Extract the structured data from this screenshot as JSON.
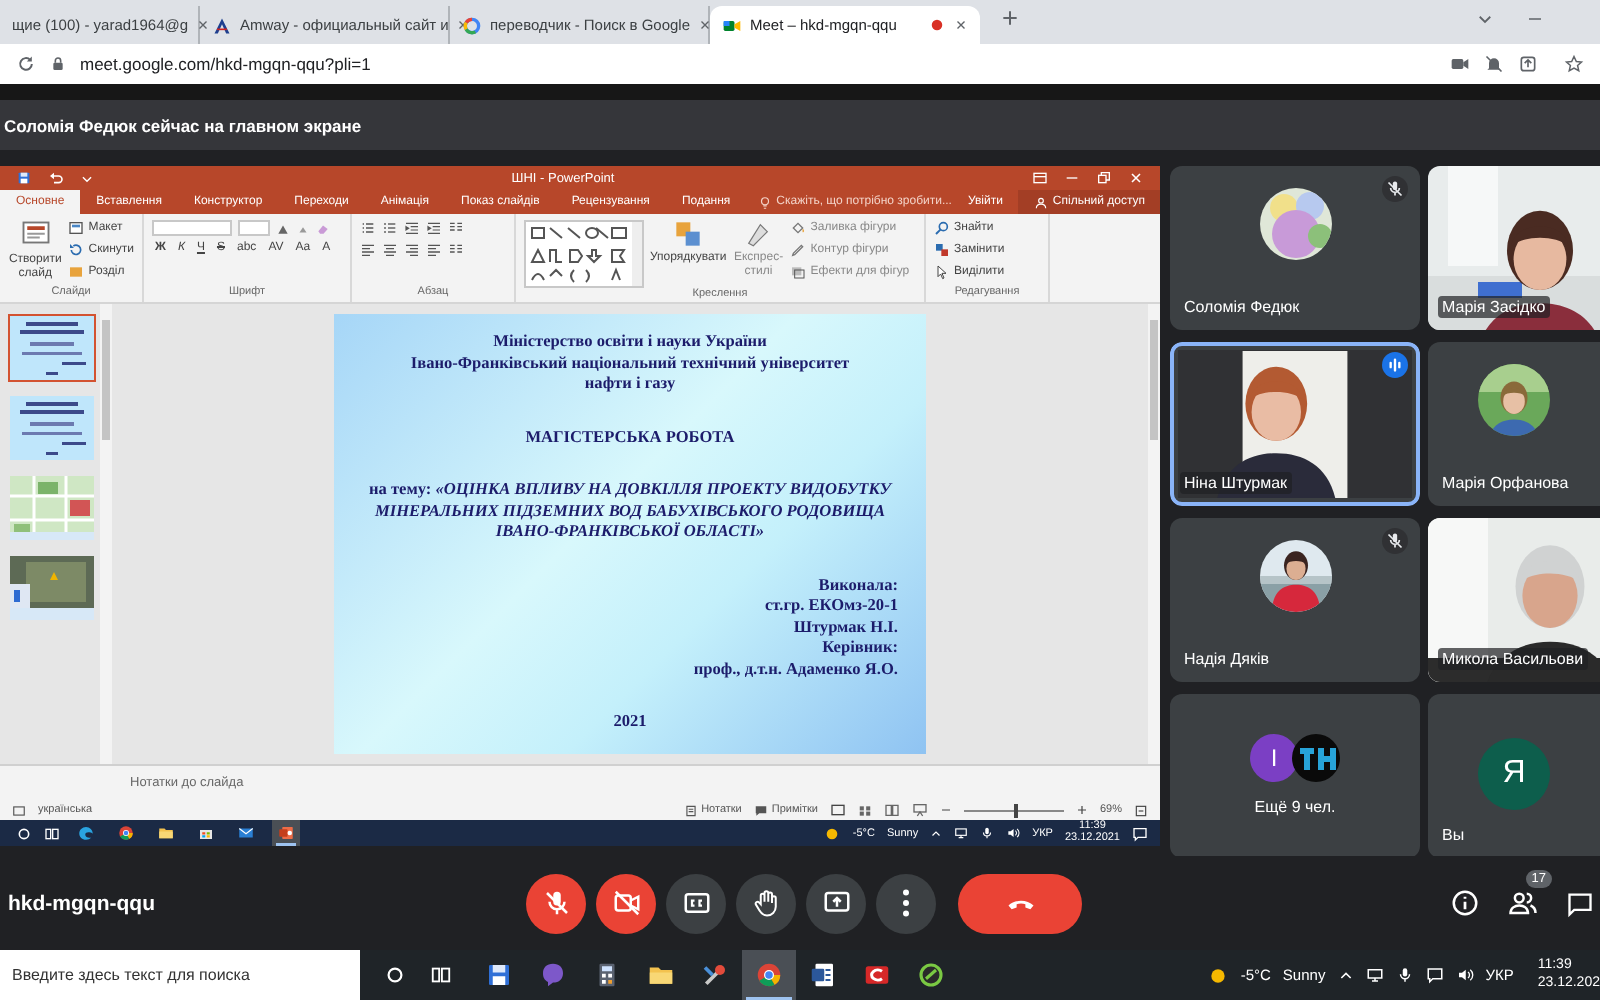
{
  "browser": {
    "tabs": [
      {
        "title": "щие (100) - yarad1964@g",
        "kind": "none",
        "selected": false,
        "recording": false
      },
      {
        "title": "Amway - официальный сайт и",
        "kind": "amway",
        "selected": false,
        "recording": false
      },
      {
        "title": "переводчик - Поиск в Google",
        "kind": "google",
        "selected": false,
        "recording": false
      },
      {
        "title": "Meet – hkd-mgqn-qqu",
        "kind": "meet",
        "selected": true,
        "recording": true
      }
    ],
    "url": "meet.google.com/hkd-mgqn-qqu?pli=1"
  },
  "meet": {
    "presenter_banner": "Соломія Федюк сейчас на главном экране",
    "participants": [
      {
        "name": "Соломія Федюк",
        "kind": "avatar",
        "muted": true,
        "speaking": false
      },
      {
        "name": "Марія Засідко",
        "kind": "video",
        "muted": false,
        "speaking": false
      },
      {
        "name": "Ніна Штурмак",
        "kind": "video",
        "muted": false,
        "speaking": true
      },
      {
        "name": "Марія Орфанова",
        "kind": "avatar",
        "muted": false,
        "speaking": false
      },
      {
        "name": "Надія Дяків",
        "kind": "avatar",
        "muted": true,
        "speaking": false
      },
      {
        "name": "Микола Васильови",
        "kind": "video",
        "muted": false,
        "speaking": false
      },
      {
        "name": "Ещё 9 чел.",
        "kind": "others",
        "muted": false,
        "speaking": false,
        "avatars": [
          {
            "kind": "initial",
            "initial": "I",
            "color": "#7b3fc4"
          },
          {
            "kind": "picture"
          }
        ]
      },
      {
        "name": "Вы",
        "kind": "self",
        "muted": false,
        "speaking": false,
        "initial": "Я",
        "color": "#0d5e4c"
      }
    ],
    "meeting_code": "hkd-mgqn-qqu",
    "controls": [
      {
        "kind": "mic",
        "off": true
      },
      {
        "kind": "camera",
        "off": true
      },
      {
        "kind": "captions",
        "off": false
      },
      {
        "kind": "hand",
        "off": false
      },
      {
        "kind": "present",
        "off": false
      },
      {
        "kind": "more",
        "off": false
      },
      {
        "kind": "hangup",
        "off": false
      }
    ],
    "people_count": "17"
  },
  "presentation": {
    "title": "ШНІ - PowerPoint",
    "tabs": [
      {
        "label": "Основне",
        "selected": true
      },
      {
        "label": "Вставлення",
        "selected": false
      },
      {
        "label": "Конструктор",
        "selected": false
      },
      {
        "label": "Переходи",
        "selected": false
      },
      {
        "label": "Анімація",
        "selected": false
      },
      {
        "label": "Показ слайдів",
        "selected": false
      },
      {
        "label": "Рецензування",
        "selected": false
      },
      {
        "label": "Подання",
        "selected": false
      }
    ],
    "tell_me": "Скажіть, що потрібно зробити...",
    "sign_in": "Увійти",
    "share": "Спільний доступ",
    "ribbon": {
      "slides": {
        "new_slide": "Створити слайд",
        "layout": "Макет",
        "reset": "Скинути",
        "section": "Розділ",
        "label": "Слайди"
      },
      "font": {
        "buttons": [
          "Ж",
          "К",
          "Ч",
          "S",
          "abc",
          "AV",
          "Aa",
          "A"
        ],
        "label": "Шрифт"
      },
      "paragraph": {
        "label": "Абзац"
      },
      "drawing": {
        "arrange": "Упорядкувати",
        "quick_styles": "Експрес-стилі",
        "fill": "Заливка фігури",
        "outline": "Контур фігури",
        "effects": "Ефекти для фігур",
        "label": "Креслення"
      },
      "editing": {
        "find": "Знайти",
        "replace": "Замінити",
        "select": "Виділити",
        "label": "Редагування"
      }
    },
    "thumbnails": [
      {
        "kind": "text",
        "selected": true
      },
      {
        "kind": "text",
        "selected": false
      },
      {
        "kind": "map",
        "selected": false
      },
      {
        "kind": "aerial",
        "selected": false
      }
    ],
    "slide": {
      "blocks": [
        {
          "kind": "center",
          "lines": [
            "Міністерство освіти і науки України",
            "Івано-Франківський національний технічний університет",
            "нафти і газу"
          ]
        },
        {
          "kind": "center",
          "lines": [
            "МАГІСТЕРСЬКА РОБОТА"
          ]
        },
        {
          "kind": "center",
          "lines": [
            "на тему:  *«ОЦІНКА ВПЛИВУ НА ДОВКІЛЛЯ ПРОЕКТУ ВИДОБУТКУ МІНЕРАЛЬНИХ ПІДЗЕМНИХ ВОД БАБУХІВСЬКОГО РОДОВИЩА ІВАНО-ФРАНКІВСЬКОЇ ОБЛАСТІ»*"
          ]
        },
        {
          "kind": "right",
          "lines": [
            "Виконала:",
            "ст.гр. ЕКОмз-20-1",
            "Штурмак Н.І.",
            "Керівник:",
            "проф., д.т.н. Адаменко Я.О."
          ]
        },
        {
          "kind": "center",
          "lines": [
            "2021"
          ]
        }
      ]
    },
    "notes_placeholder": "Нотатки до слайда",
    "status": {
      "language": "українська",
      "notes": "Нотатки",
      "comments": "Примітки",
      "zoom": "69%",
      "zoom_slider": {
        "level": 0.5
      }
    },
    "taskbar": {
      "apps": [
        {
          "kind": "edge",
          "active": false
        },
        {
          "kind": "chrome",
          "active": false
        },
        {
          "kind": "folder",
          "active": false
        },
        {
          "kind": "store",
          "active": false
        },
        {
          "kind": "mail",
          "active": false
        },
        {
          "kind": "powerpoint",
          "active": true
        }
      ],
      "temperature": "-5°C",
      "condition": "Sunny",
      "language": "УКР",
      "time": "11:39",
      "date": "23.12.2021"
    }
  },
  "taskbar": {
    "search_placeholder": "Введите здесь текст для поиска",
    "apps": [
      {
        "kind": "save",
        "active": false
      },
      {
        "kind": "viber",
        "active": false
      },
      {
        "kind": "calculator",
        "active": false
      },
      {
        "kind": "folder",
        "active": false
      },
      {
        "kind": "tool",
        "active": false
      },
      {
        "kind": "chrome",
        "active": true
      },
      {
        "kind": "word",
        "active": false
      },
      {
        "kind": "red",
        "active": false
      },
      {
        "kind": "green",
        "active": false
      }
    ],
    "temperature": "-5°C",
    "condition": "Sunny",
    "language": "УКР",
    "time": "11:39",
    "date": "23.12.202"
  }
}
